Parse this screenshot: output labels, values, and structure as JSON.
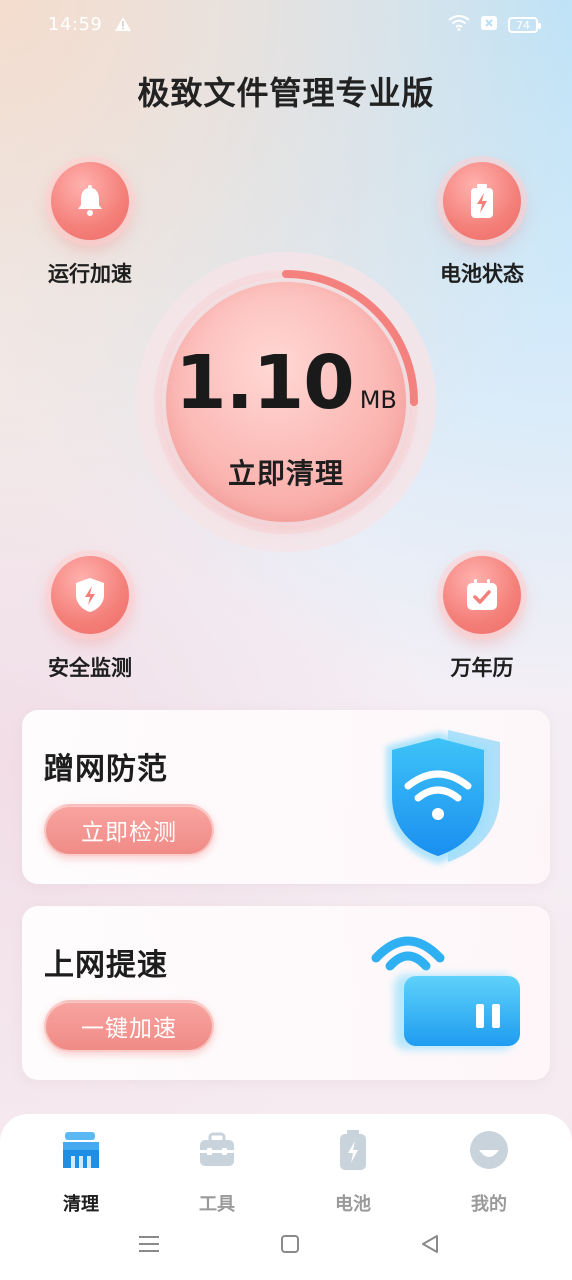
{
  "status_bar": {
    "time": "14:59",
    "battery": "74"
  },
  "app": {
    "title": "极致文件管理专业版"
  },
  "features": {
    "top_left": {
      "label": "运行加速",
      "icon": "bell-icon"
    },
    "top_right": {
      "label": "电池状态",
      "icon": "battery-icon"
    },
    "bottom_left": {
      "label": "安全监测",
      "icon": "shield-icon"
    },
    "bottom_right": {
      "label": "万年历",
      "icon": "calendar-icon"
    }
  },
  "gauge": {
    "value": "1.10",
    "unit": "MB",
    "action": "立即清理",
    "progress": 0.25
  },
  "cards": [
    {
      "title": "蹭网防范",
      "button": "立即检测",
      "icon": "wifi-shield-icon"
    },
    {
      "title": "上网提速",
      "button": "一键加速",
      "icon": "router-icon"
    }
  ],
  "bottom_nav": [
    {
      "label": "清理",
      "icon": "broom-icon",
      "active": true
    },
    {
      "label": "工具",
      "icon": "toolbox-icon",
      "active": false
    },
    {
      "label": "电池",
      "icon": "battery-icon",
      "active": false
    },
    {
      "label": "我的",
      "icon": "profile-icon",
      "active": false
    }
  ],
  "colors": {
    "accent": "#f08b86",
    "nav_active": "#2f8fe0",
    "nav_inactive": "#c9d3dc"
  }
}
